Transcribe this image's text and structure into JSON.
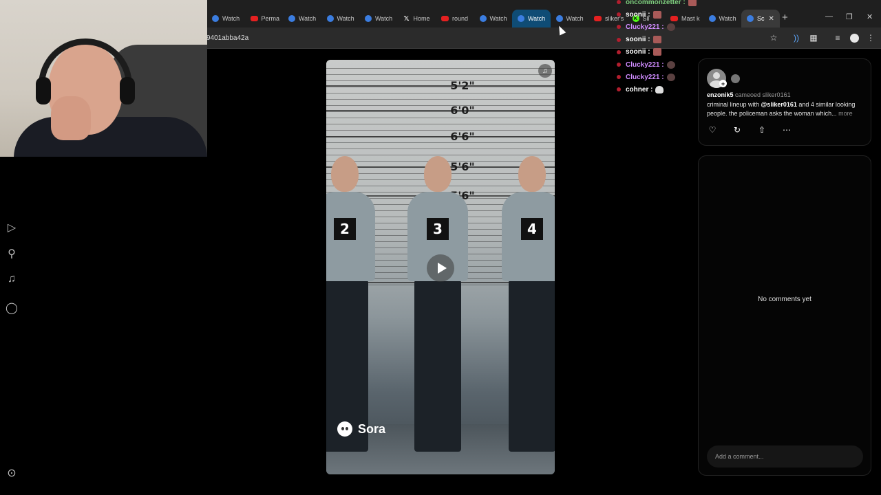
{
  "browser": {
    "tabs": [
      {
        "title": "Watch",
        "icon": "sora-icon"
      },
      {
        "title": "Perma",
        "icon": "youtube-icon"
      },
      {
        "title": "Watch",
        "icon": "sora-icon"
      },
      {
        "title": "Watch",
        "icon": "sora-icon"
      },
      {
        "title": "Watch",
        "icon": "sora-icon"
      },
      {
        "title": "Home",
        "icon": "x-icon"
      },
      {
        "title": "round",
        "icon": "youtube-icon"
      },
      {
        "title": "Watch",
        "icon": "sora-icon"
      },
      {
        "title": "Watch",
        "icon": "sora-icon"
      },
      {
        "title": "Watch",
        "icon": "sora-icon"
      },
      {
        "title": "sliker's",
        "icon": "youtube-icon"
      },
      {
        "title": "Sli",
        "icon": "kick-icon"
      },
      {
        "title": "Mast k",
        "icon": "youtube-icon"
      },
      {
        "title": "Watch",
        "icon": "sora-icon"
      },
      {
        "title": "Sc",
        "icon": "sora-icon"
      }
    ],
    "new_tab_glyph": "+",
    "url": "9401abba42a"
  },
  "chat": [
    {
      "user": "oncommonzetter :",
      "color": "#7fd17f"
    },
    {
      "user": "soonii :",
      "color": "#ffffff"
    },
    {
      "user": "Clucky221 :",
      "color": "#d08cff"
    },
    {
      "user": "soonii :",
      "color": "#ffffff"
    },
    {
      "user": "soonii :",
      "color": "#ffffff"
    },
    {
      "user": "Clucky221 :",
      "color": "#d08cff"
    },
    {
      "user": "Clucky221 :",
      "color": "#d08cff"
    },
    {
      "user": "cohner :",
      "color": "#ffffff"
    }
  ],
  "video": {
    "height_labels": [
      "5'2\"",
      "6'0\"",
      "6'6\"",
      "5'6\"",
      "5'6\"",
      "5'"
    ],
    "suspect_numbers": [
      "2",
      "3",
      "4"
    ],
    "watermark": "Sora"
  },
  "post": {
    "username": "enzonik5",
    "cameo_text": "cameoed sliker0161",
    "caption_pre": "criminal lineup with ",
    "mention": "@sliker0161",
    "caption_post": " and 4 similar looking people. the policeman asks the woman which...",
    "more_label": "more"
  },
  "comments": {
    "empty_text": "No comments yet",
    "placeholder": "Add a comment..."
  },
  "colors": {
    "active_tab": "#0f4c75",
    "background": "#000000",
    "panel_border": "#222222"
  }
}
